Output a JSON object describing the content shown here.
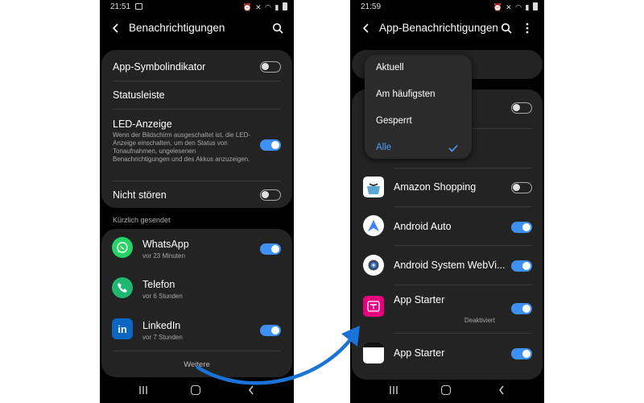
{
  "left_phone": {
    "status": {
      "time": "21:51"
    },
    "header": {
      "title": "Benachrichtigungen"
    },
    "settings": [
      {
        "title": "App-Symbolindikator",
        "toggle": "off"
      },
      {
        "title": "Statusleiste"
      },
      {
        "title": "LED-Anzeige",
        "subtitle": "Wenn der Bildschirm ausgeschaltet ist, die LED-Anzeige einschalten, um den Status von Tonaufnahmen, ungelesenen Benachrichtigungen und des Akkus anzuzeigen.",
        "toggle": "on"
      },
      {
        "title": "Nicht stören",
        "toggle": "off"
      }
    ],
    "recent_label": "Kürzlich gesendet",
    "recent_apps": [
      {
        "name": "WhatsApp",
        "time": "vor 23 Minuten",
        "icon": "whatsapp-icon",
        "color": "#25d366",
        "toggle": "on"
      },
      {
        "name": "Telefon",
        "time": "vor 6 Stunden",
        "icon": "phone-icon",
        "color": "#1fb870",
        "toggle": "on"
      },
      {
        "name": "LinkedIn",
        "time": "vor 7 Stunden",
        "icon": "linkedin-icon",
        "color": "#0a66c2",
        "toggle": "on"
      }
    ],
    "more_label": "Weitere"
  },
  "right_phone": {
    "status": {
      "time": "21:59"
    },
    "header": {
      "title": "App-Benachrichtigungen"
    },
    "dropdown": {
      "options": [
        "Aktuell",
        "Am häufigsten",
        "Gesperrt",
        "Alle"
      ],
      "selected": "Alle"
    },
    "apps": [
      {
        "name": "Amazon Shopping",
        "toggle": "off",
        "icon": "amazon-icon"
      },
      {
        "name": "Android Auto",
        "toggle": "on",
        "icon": "android-auto-icon"
      },
      {
        "name": "Android System WebVi...",
        "toggle": "on",
        "icon": "webview-gear-icon"
      },
      {
        "name": "App Starter",
        "status": "Deaktiviert",
        "toggle": "on",
        "icon": "telekom-app-starter-icon"
      },
      {
        "name": "App Starter",
        "toggle": "on",
        "icon": "app-starter-icon"
      }
    ]
  },
  "colors": {
    "accent": "#3e91f2",
    "card": "#232323",
    "background": "#000000"
  }
}
